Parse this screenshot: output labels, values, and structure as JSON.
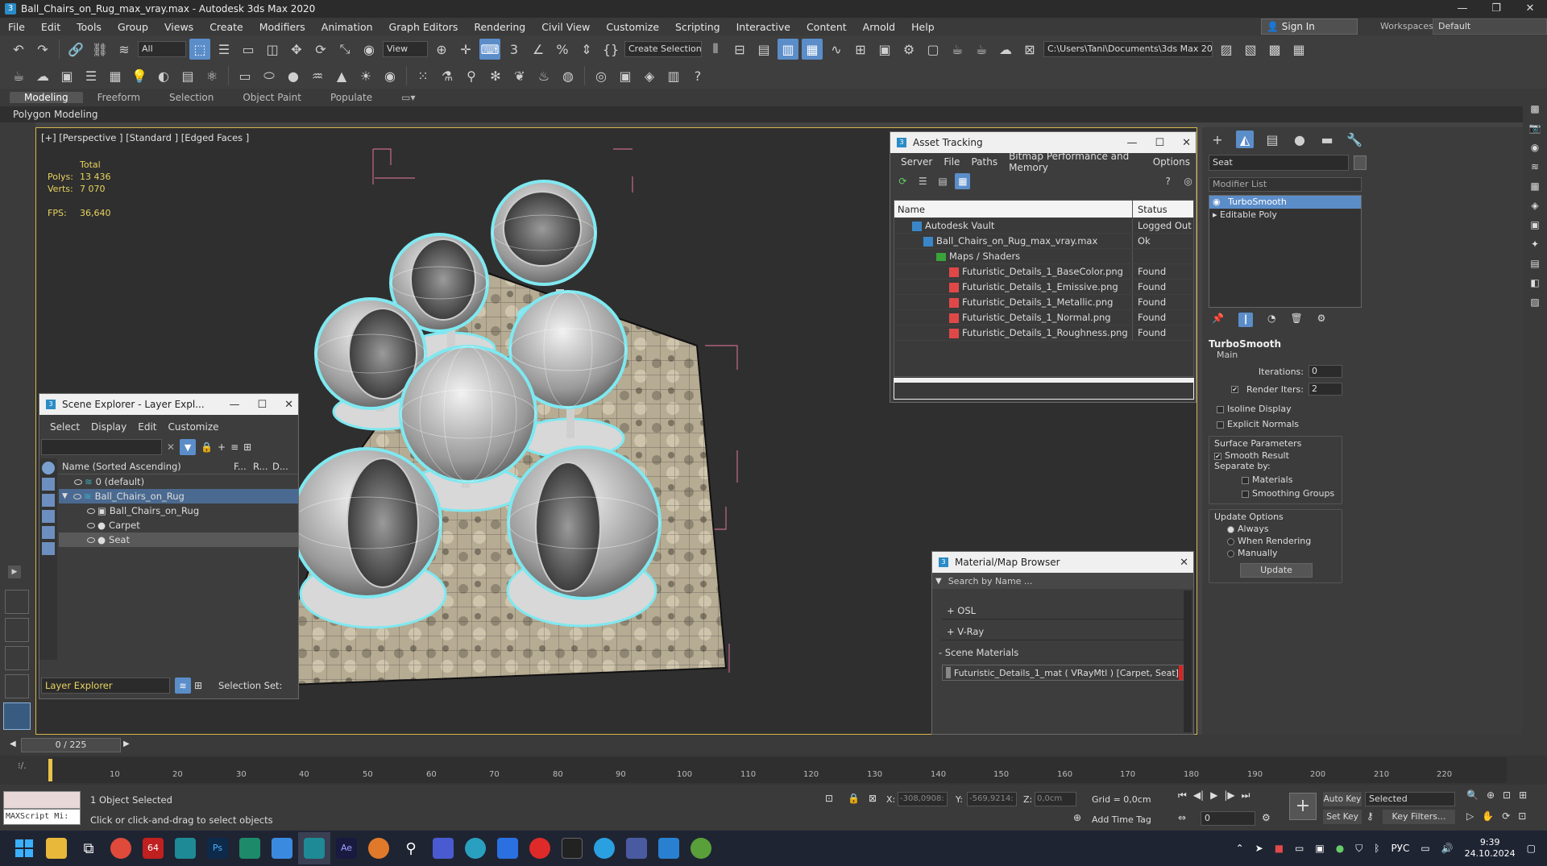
{
  "window": {
    "title": "Ball_Chairs_on_Rug_max_vray.max - Autodesk 3ds Max 2020",
    "icon": "3"
  },
  "menu": [
    "File",
    "Edit",
    "Tools",
    "Group",
    "Views",
    "Create",
    "Modifiers",
    "Animation",
    "Graph Editors",
    "Rendering",
    "Civil View",
    "Customize",
    "Scripting",
    "Interactive",
    "Content",
    "Arnold",
    "Help"
  ],
  "signin": "Sign In",
  "workspace_label": "Workspaces:",
  "workspace_value": "Default",
  "toolbar": {
    "filter": "All",
    "refcoord": "View",
    "selset": "Create Selection Se",
    "path": "C:\\Users\\Tani\\Documents\\3ds Max 2020"
  },
  "ribbon": {
    "tabs": [
      "Modeling",
      "Freeform",
      "Selection",
      "Object Paint",
      "Populate"
    ],
    "sub": "Polygon Modeling"
  },
  "viewport": {
    "label": "[+] [Perspective ] [Standard ] [Edged Faces ]",
    "total": "Total",
    "polys_k": "Polys:",
    "polys_v": "13 436",
    "verts_k": "Verts:",
    "verts_v": "7 070",
    "fps_k": "FPS:",
    "fps_v": "36,640"
  },
  "asset": {
    "title": "Asset Tracking",
    "menu": [
      "Server",
      "File",
      "Paths",
      "Bitmap Performance and Memory",
      "Options"
    ],
    "col_name": "Name",
    "col_status": "Status",
    "rows": [
      {
        "name": "Autodesk Vault",
        "status": "Logged Out ..."
      },
      {
        "name": "Ball_Chairs_on_Rug_max_vray.max",
        "status": "Ok"
      },
      {
        "name": "Maps / Shaders",
        "status": ""
      },
      {
        "name": "Futuristic_Details_1_BaseColor.png",
        "status": "Found"
      },
      {
        "name": "Futuristic_Details_1_Emissive.png",
        "status": "Found"
      },
      {
        "name": "Futuristic_Details_1_Metallic.png",
        "status": "Found"
      },
      {
        "name": "Futuristic_Details_1_Normal.png",
        "status": "Found"
      },
      {
        "name": "Futuristic_Details_1_Roughness.png",
        "status": "Found"
      }
    ]
  },
  "scene": {
    "title": "Scene Explorer - Layer Expl...",
    "menu": [
      "Select",
      "Display",
      "Edit",
      "Customize"
    ],
    "col_name": "Name (Sorted Ascending)",
    "cols": [
      "F...",
      "R...",
      "D..."
    ],
    "rows": [
      "0 (default)",
      "Ball_Chairs_on_Rug",
      "Ball_Chairs_on_Rug",
      "Carpet",
      "Seat"
    ],
    "footer": "Layer Explorer",
    "selset": "Selection Set:"
  },
  "material": {
    "title": "Material/Map Browser",
    "search": "Search by Name ...",
    "groups": [
      "+ OSL",
      "+ V-Ray"
    ],
    "scene_mats": "- Scene Materials",
    "mat": "Futuristic_Details_1_mat ( VRayMtl ) [Carpet, Seat]"
  },
  "modify": {
    "name": "Seat",
    "list": "Modifier List",
    "stack": [
      "TurboSmooth",
      "Editable Poly"
    ],
    "rollout": "TurboSmooth",
    "main": "Main",
    "iter_k": "Iterations:",
    "iter_v": "0",
    "render_k": "Render Iters:",
    "render_v": "2",
    "isoline": "Isoline Display",
    "explicit": "Explicit Normals",
    "surface": "Surface Parameters",
    "smooth": "Smooth Result",
    "sepby": "Separate by:",
    "materials": "Materials",
    "sgroups": "Smoothing Groups",
    "update_opts": "Update Options",
    "always": "Always",
    "when": "When Rendering",
    "manually": "Manually",
    "update_btn": "Update"
  },
  "timeline": {
    "frame": "0 / 225",
    "ticks": [
      "10",
      "20",
      "30",
      "40",
      "50",
      "60",
      "70",
      "80",
      "90",
      "100",
      "110",
      "120",
      "130",
      "140",
      "150",
      "160",
      "170",
      "180",
      "190",
      "200",
      "210",
      "220"
    ]
  },
  "status": {
    "maxscript": "MAXScript Mi:",
    "selected": "1 Object Selected",
    "hint": "Click or click-and-drag to select objects",
    "x_k": "X:",
    "x_v": "-308,0908:",
    "y_k": "Y:",
    "y_v": "-569,9214:",
    "z_k": "Z:",
    "z_v": "0,0cm",
    "grid": "Grid = 0,0cm",
    "addtag": "Add Time Tag",
    "autokey": "Auto Key",
    "setkey": "Set Key",
    "selsel": "Selected",
    "keyfilters": "Key Filters...",
    "frame": "0"
  },
  "taskbar": {
    "lang": "РУС",
    "time": "9:39",
    "date": "24.10.2024"
  },
  "colors": {
    "accent": "#5b8dc9",
    "cyan": "#7fe8f0",
    "viewport_border": "#d6b64a"
  }
}
